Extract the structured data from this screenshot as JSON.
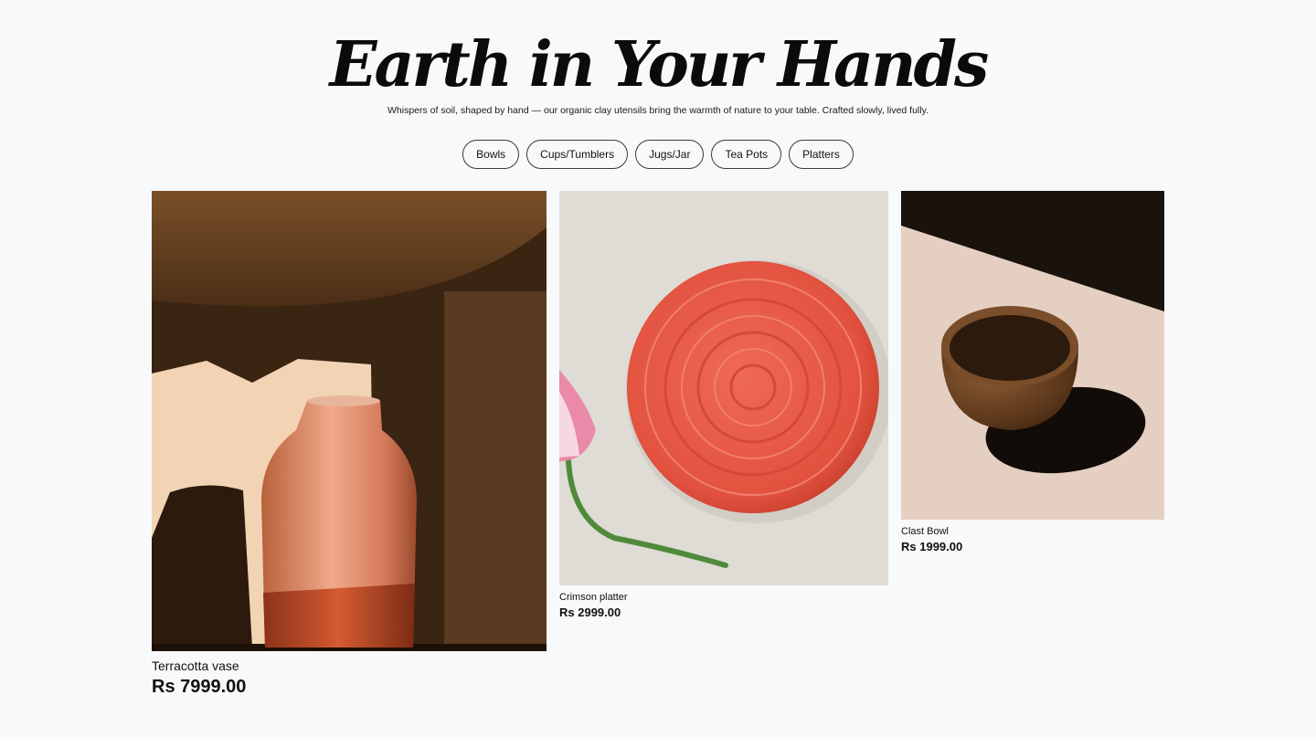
{
  "hero": {
    "title": "Earth in Your Hands",
    "subtitle": "Whispers of soil, shaped by hand — our organic clay utensils bring the warmth of nature to your table. Crafted slowly, lived fully."
  },
  "filters": [
    "Bowls",
    "Cups/Tumblers",
    "Jugs/Jar",
    "Tea Pots",
    "Platters"
  ],
  "products": [
    {
      "name": "Terracotta vase",
      "price": "Rs 7999.00"
    },
    {
      "name": "Crimson platter",
      "price": "Rs 2999.00"
    },
    {
      "name": "Clast Bowl",
      "price": "Rs 1999.00"
    }
  ],
  "colors": {
    "background": "#f7f9fb",
    "text": "#111111",
    "platter": "#e2523f",
    "vase": "#e89a72"
  }
}
